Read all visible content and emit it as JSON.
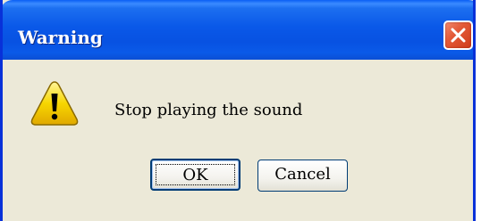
{
  "window": {
    "title": "Warning"
  },
  "dialog": {
    "message": "Stop playing the sound",
    "icon": "warning-icon"
  },
  "buttons": {
    "ok_label": "OK",
    "cancel_label": "Cancel"
  },
  "colors": {
    "titlebar": "#0a58e8",
    "window_bg": "#ece9d8",
    "close_button": "#e35a38",
    "warning_yellow": "#f7d600"
  }
}
